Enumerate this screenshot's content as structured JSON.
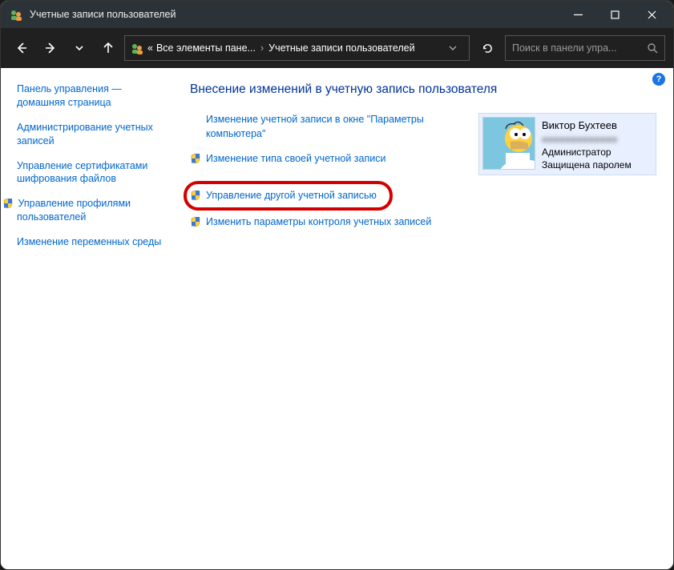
{
  "titlebar": {
    "title": "Учетные записи пользователей"
  },
  "breadcrumb": {
    "prefix": "«",
    "seg1": "Все элементы пане...",
    "seg2": "Учетные записи пользователей"
  },
  "search": {
    "placeholder": "Поиск в панели упра..."
  },
  "sidebar": {
    "items": [
      {
        "label": "Панель управления — домашняя страница",
        "shield": false
      },
      {
        "label": "Администрирование учетных записей",
        "shield": false
      },
      {
        "label": "Управление сертификатами шифрования файлов",
        "shield": false
      },
      {
        "label": "Управление профилями пользователей",
        "shield": true
      },
      {
        "label": "Изменение переменных среды",
        "shield": false
      }
    ]
  },
  "main": {
    "heading": "Внесение изменений в учетную запись пользователя",
    "tasks": [
      {
        "label": "Изменение учетной записи в окне \"Параметры компьютера\"",
        "shield": false
      },
      {
        "label": "Изменение типа своей учетной записи",
        "shield": true
      },
      {
        "label": "Управление другой учетной записью",
        "shield": true,
        "highlighted": true
      },
      {
        "label": "Изменить параметры контроля учетных записей",
        "shield": true
      }
    ]
  },
  "user": {
    "name": "Виктор Бухтеев",
    "email_masked": "●●●●●●●●●●●●●",
    "role": "Администратор",
    "password": "Защищена паролем"
  }
}
